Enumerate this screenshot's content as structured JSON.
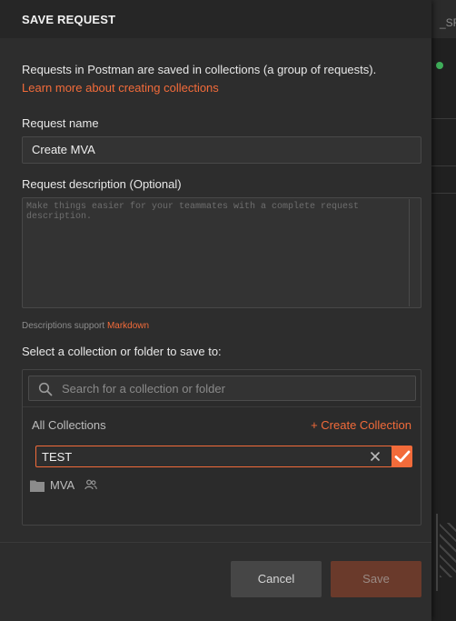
{
  "background": {
    "tab_fragment": "_SR"
  },
  "modal": {
    "title": "SAVE REQUEST",
    "intro_text": "Requests in Postman are saved in collections (a group of requests).",
    "intro_link": "Learn more about creating collections",
    "request_name": {
      "label": "Request name",
      "value": "Create MVA"
    },
    "request_description": {
      "label": "Request description (Optional)",
      "placeholder": "Make things easier for your teammates with a complete request description."
    },
    "markdown_note": {
      "prefix": "Descriptions support",
      "link": "Markdown"
    },
    "collection_picker": {
      "label": "Select a collection or folder to save to:",
      "search_placeholder": "Search for a collection or folder",
      "all_collections": "All Collections",
      "create_collection": "+ Create Collection",
      "new_collection_value": "TEST",
      "items": [
        {
          "name": "MVA",
          "icon": "folder-icon",
          "shared_icon": "team-icon"
        }
      ]
    },
    "buttons": {
      "cancel": "Cancel",
      "save": "Save"
    },
    "colors": {
      "accent": "#f26b3a",
      "modal_bg": "#2d2d2d",
      "save_disabled_bg": "#6a3a2b"
    }
  }
}
